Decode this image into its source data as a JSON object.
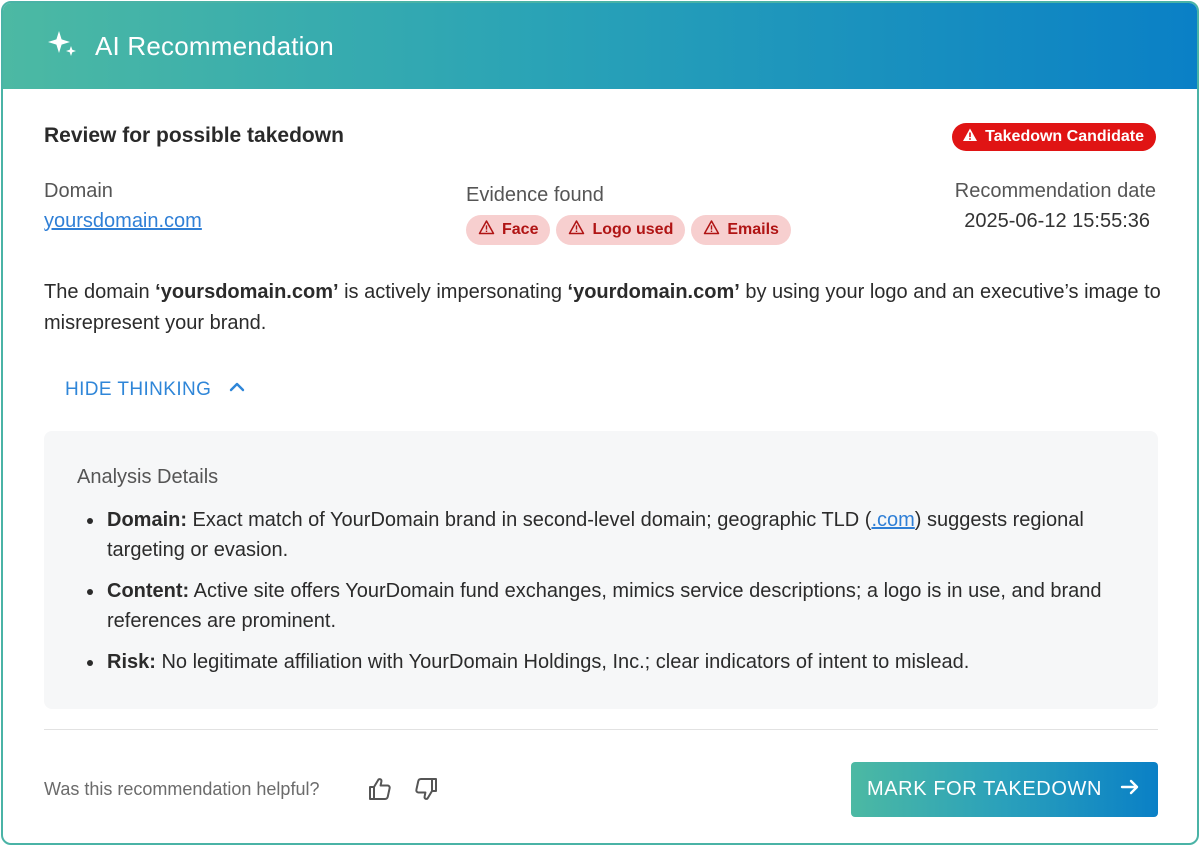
{
  "header": {
    "title": "AI Recommendation",
    "icon": "sparkles-icon"
  },
  "review": {
    "title": "Review for possible takedown",
    "badge": "Takedown Candidate",
    "badge_color": "#e01414"
  },
  "meta": {
    "domain_label": "Domain",
    "domain_value": "yoursdomain.com",
    "evidence_label": "Evidence found",
    "evidence_chips": [
      "Face",
      "Logo used",
      "Emails"
    ],
    "date_label": "Recommendation date",
    "date_value": "2025-06-12 15:55:36"
  },
  "summary": {
    "part1": "The domain ",
    "bold1": "‘yoursdomain.com’",
    "part2": " is actively impersonating ",
    "bold2": "‘yourdomain.com’",
    "part3": " by using your logo and an executive’s image to misrepresent your brand."
  },
  "toggle": {
    "label": "HIDE THINKING"
  },
  "analysis": {
    "title": "Analysis Details",
    "items": [
      {
        "key": "Domain:",
        "text_before": " Exact match of YourDomain brand in second-level domain; geographic TLD (",
        "link": ".com",
        "text_after": ") suggests regional targeting or evasion."
      },
      {
        "key": "Content:",
        "text": " Active site offers YourDomain fund exchanges, mimics service descriptions; a logo is in use, and brand references are prominent."
      },
      {
        "key": "Risk:",
        "text": " No legitimate affiliation with YourDomain Holdings, Inc.; clear indicators of intent to mislead."
      }
    ]
  },
  "footer": {
    "helpful_text": "Was this recommendation helpful?",
    "thumb_up_icon": "thumbs-up-icon",
    "thumb_down_icon": "thumbs-down-icon",
    "cta_label": "MARK FOR TAKEDOWN"
  },
  "colors": {
    "accent_start": "#4cb9a3",
    "accent_end": "#0a80c6",
    "link": "#2f7fd6",
    "chip_bg": "#f7cfcf",
    "chip_text": "#b01414"
  }
}
